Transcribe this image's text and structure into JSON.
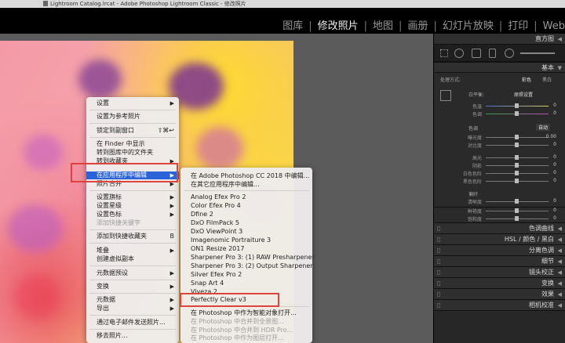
{
  "window": {
    "title": "Lightroom Catalog.lrcat - Adobe Photoshop Lightroom Classic - 修改照片"
  },
  "modules": [
    {
      "label": "图库"
    },
    {
      "label": "修改照片",
      "active": true
    },
    {
      "label": "地图"
    },
    {
      "label": "画册"
    },
    {
      "label": "幻灯片放映"
    },
    {
      "label": "打印"
    },
    {
      "label": "Web"
    }
  ],
  "right_panel": {
    "histogram_title": "直方图",
    "basic_title": "基本",
    "treatment_label": "处理方式:",
    "treatment_color": "彩色",
    "treatment_bw": "黑白",
    "wb_label": "白平衡:",
    "wb_value": "原照设置",
    "sliders": [
      {
        "label": "色温",
        "value": "0"
      },
      {
        "label": "色调",
        "value": "0"
      },
      {
        "label": "曝光度",
        "value": "0.00"
      },
      {
        "label": "对比度",
        "value": "0"
      },
      {
        "label": "高光",
        "value": "0"
      },
      {
        "label": "阴影",
        "value": "0"
      },
      {
        "label": "白色色阶",
        "value": "0"
      },
      {
        "label": "黑色色阶",
        "value": "0"
      },
      {
        "label": "清晰度",
        "value": "0"
      },
      {
        "label": "鲜艳度",
        "value": "0"
      },
      {
        "label": "饱和度",
        "value": "0"
      }
    ],
    "tone_label": "色调",
    "tone_auto": "自动",
    "presence_label": "偏好",
    "sections": [
      "色调曲线",
      "HSL / 颜色 / 黑白",
      "分离色调",
      "细节",
      "镜头校正",
      "变换",
      "效果",
      "相机校准"
    ]
  },
  "context_menu": {
    "items": [
      {
        "label": "设置",
        "submenu": true
      },
      {
        "label": "设置为参考照片"
      },
      {
        "label": "锁定到副窗口",
        "shortcut": "⇧⌘↩"
      },
      {
        "label": "在 Finder 中显示"
      },
      {
        "label": "转到图库中的文件夹"
      },
      {
        "label": "转到收藏夹",
        "submenu": true
      },
      {
        "label": "在应用程序中编辑",
        "submenu": true,
        "highlighted": true
      },
      {
        "label": "照片合并",
        "submenu": true
      },
      {
        "label": "设置旗标",
        "submenu": true
      },
      {
        "label": "设置星级",
        "submenu": true
      },
      {
        "label": "设置色标",
        "submenu": true
      },
      {
        "label": "添加快捷关键字",
        "disabled": true
      },
      {
        "label": "添加到快捷收藏夹",
        "shortcut": "B"
      },
      {
        "label": "堆叠",
        "submenu": true
      },
      {
        "label": "创建虚拟副本"
      },
      {
        "label": "元数据预设",
        "submenu": true
      },
      {
        "label": "变换",
        "submenu": true
      },
      {
        "label": "元数据",
        "submenu": true
      },
      {
        "label": "导出",
        "submenu": true
      },
      {
        "label": "通过电子邮件发送照片..."
      },
      {
        "label": "移去照片..."
      }
    ]
  },
  "submenu": {
    "items": [
      {
        "label": "在 Adobe Photoshop CC 2018 中编辑..."
      },
      {
        "label": "在其它应用程序中编辑..."
      },
      {
        "label": "Analog Efex Pro 2"
      },
      {
        "label": "Color Efex Pro 4"
      },
      {
        "label": "Dfine 2"
      },
      {
        "label": "DxO FilmPack 5"
      },
      {
        "label": "DxO ViewPoint 3"
      },
      {
        "label": "Imagenomic Portraiture 3"
      },
      {
        "label": "ON1 Resize 2017"
      },
      {
        "label": "Sharpener Pro 3: (1) RAW Presharpener"
      },
      {
        "label": "Sharpener Pro 3: (2) Output Sharpener"
      },
      {
        "label": "Silver Efex Pro 2"
      },
      {
        "label": "Snap Art 4"
      },
      {
        "label": "Viveza 2"
      },
      {
        "label": "Perfectly Clear v3"
      },
      {
        "label": "在 Photoshop 中作为智能对象打开..."
      },
      {
        "label": "在 Photoshop 中合并到全景图...",
        "disabled": true
      },
      {
        "label": "在 Photoshop 中合并到 HDR Pro...",
        "disabled": true
      },
      {
        "label": "在 Photoshop 中作为图层打开...",
        "disabled": true
      }
    ]
  },
  "colors": {
    "menu_highlight": "#2a63d7",
    "callout_red": "#e0433b"
  }
}
